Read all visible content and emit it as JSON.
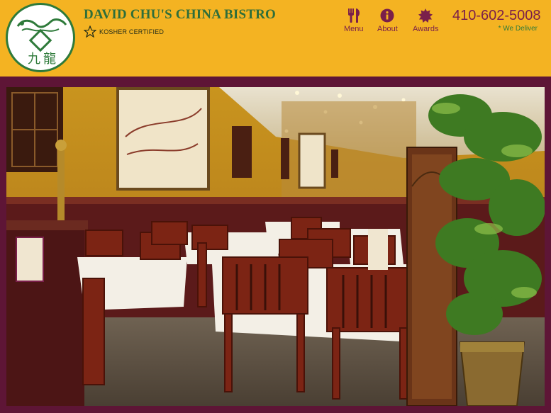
{
  "brand": {
    "name": "DAVID CHU'S CHINA BISTRO",
    "badge": "KOSHER CERTIFIED",
    "logo_icon": "dragon-logo-icon"
  },
  "nav": {
    "items": [
      {
        "label": "Menu",
        "icon": "fork-knife-icon"
      },
      {
        "label": "About",
        "icon": "info-icon"
      },
      {
        "label": "Awards",
        "icon": "award-seal-icon"
      }
    ]
  },
  "contact": {
    "phone": "410-602-5008",
    "delivery_note": "* We Deliver"
  },
  "colors": {
    "header_bg": "#f4b322",
    "page_bg": "#5e1536",
    "accent_maroon": "#7a1f4a",
    "brand_green": "#2e6e3a"
  }
}
